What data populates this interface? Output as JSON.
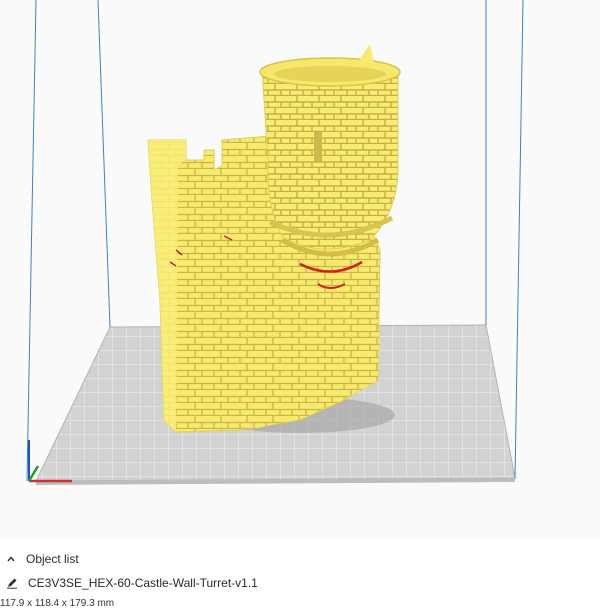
{
  "object_list": {
    "header_label": "Object list",
    "selected_object_name": "CE3V3SE_HEX-60-Castle-Wall-Turret-v1.1",
    "dimensions": "117.9 x 118.4 x 179.3 mm"
  },
  "icons": {
    "collapse": "chevron-up-icon",
    "rename": "pencil-icon"
  },
  "colors": {
    "model": "#f7ea6e",
    "model_shadow": "#d4c24f",
    "overhang": "#cc2222",
    "build_volume_lines": "#3b82c4",
    "plate": "#c8c8c8",
    "plate_grid": "#e6e6e6",
    "axis_x": "#d03030",
    "axis_y": "#20a020",
    "axis_z": "#2050d0"
  }
}
